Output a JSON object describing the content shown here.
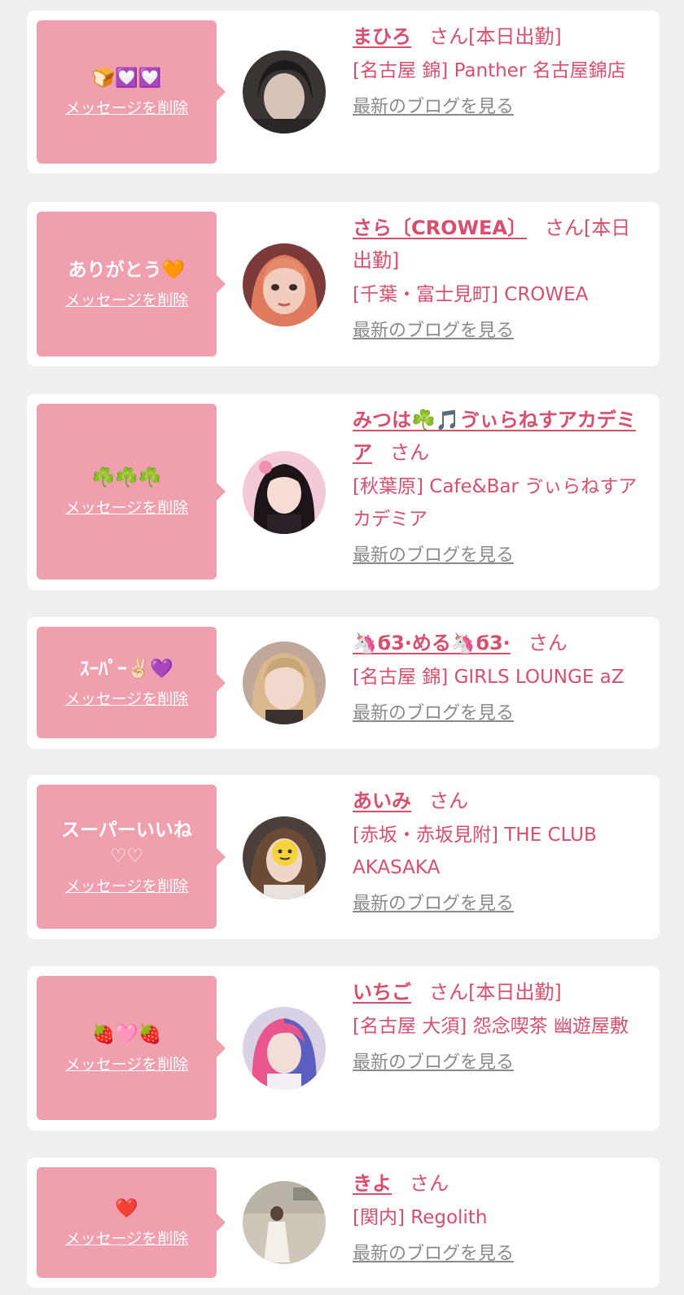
{
  "delete_label": "メッセージを削除",
  "blog_label": "最新のブログを見る",
  "entries": [
    {
      "message": "🍞💟💟",
      "name": "まひろ",
      "suffix": "さん[本日出勤]",
      "shop": "[名古屋 錦] Panther 名古屋錦店"
    },
    {
      "message": "ありがとう🧡",
      "name": "さら〔CROWEA〕",
      "suffix": "さん[本日出勤]",
      "shop": "[千葉・富士見町] CROWEA"
    },
    {
      "message": "☘️☘️☘️",
      "name": "みつは☘️🎵ゔぃらねすアカデミア",
      "suffix": "さん",
      "shop": "[秋葉原] Cafe&Bar ゔぃらねすアカデミア"
    },
    {
      "message": "ｽｰﾊﾟｰ✌🏻💜",
      "name": "🦄ϭ3·める🦄ϭ3·",
      "suffix": "さん",
      "shop": "[名古屋 錦] GIRLS LOUNGE aZ"
    },
    {
      "message": "スーパーいいね♡♡",
      "name": "あいみ",
      "suffix": "さん",
      "shop": "[赤坂・赤坂見附] THE CLUB AKASAKA"
    },
    {
      "message": "🍓🩷🍓",
      "name": "いちご",
      "suffix": "さん[本日出勤]",
      "shop": "[名古屋 大須] 怨念喫茶 幽遊屋敷"
    },
    {
      "message": "❤️",
      "name": "きよ",
      "suffix": "さん",
      "shop": "[関内] Regolith"
    }
  ]
}
